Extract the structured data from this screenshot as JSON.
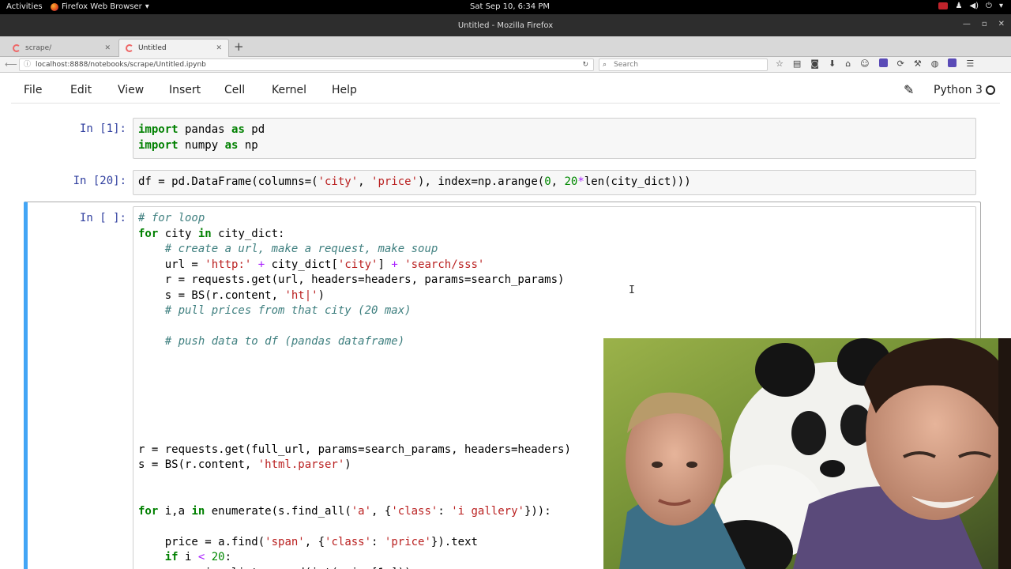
{
  "gnome": {
    "activities": "Activities",
    "app_name": "Firefox Web Browser",
    "clock": "Sat Sep 10,  6:34 PM"
  },
  "window": {
    "title": "Untitled - Mozilla Firefox"
  },
  "tabs": [
    {
      "label": "scrape/",
      "active": false
    },
    {
      "label": "Untitled",
      "active": true
    }
  ],
  "navbar": {
    "url": "localhost:8888/notebooks/scrape/Untitled.ipynb",
    "search_placeholder": "Search"
  },
  "jupyter": {
    "menus": [
      "File",
      "Edit",
      "View",
      "Insert",
      "Cell",
      "Kernel",
      "Help"
    ],
    "kernel_name": "Python 3"
  },
  "cells": {
    "c1_prompt": "In [1]:",
    "c2_prompt": "In [20]:",
    "c3_prompt": "In [ ]:"
  },
  "colors": {
    "prompt": "#303f9f",
    "selected_border": "#42a5f5",
    "keyword": "#008000",
    "string": "#ba2121",
    "comment": "#408080"
  }
}
